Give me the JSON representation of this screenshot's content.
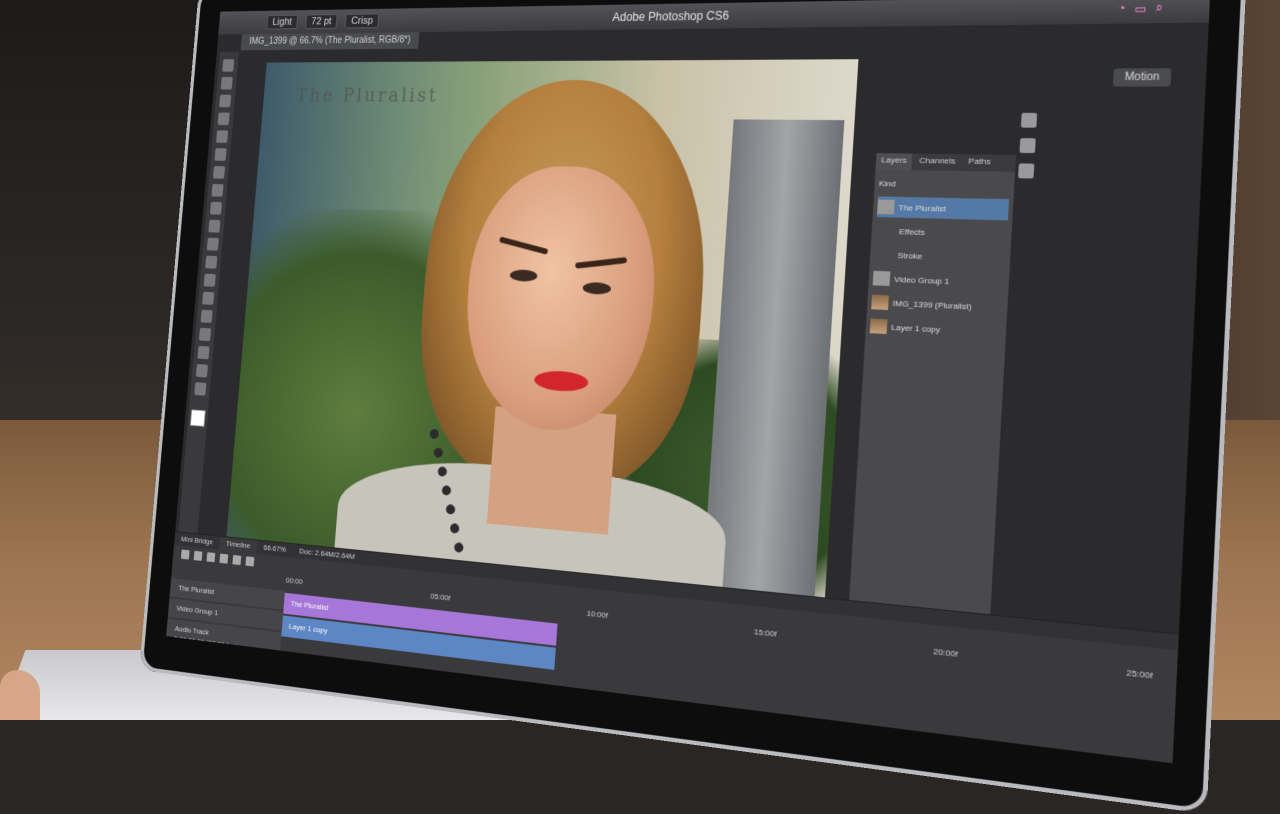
{
  "window": {
    "app_title": "Adobe Photoshop CS6",
    "doc_tab": "IMG_1399 @ 66.7% (The Pluralist, RGB/8*)"
  },
  "options_bar": {
    "style_field": "Light",
    "size_field": "72 pt",
    "aa_field": "Crisp"
  },
  "workspace": {
    "label": "Motion"
  },
  "canvas": {
    "watermark": "The Pluralist"
  },
  "layers_panel": {
    "tabs": [
      "Layers",
      "Channels",
      "Paths"
    ],
    "filter_label": "Kind",
    "layers": [
      {
        "name": "The Pluralist",
        "selected": true
      },
      {
        "name": "Effects"
      },
      {
        "name": "Stroke"
      },
      {
        "name": "Video Group 1"
      },
      {
        "name": "IMG_1399 (Pluralist)"
      },
      {
        "name": "Layer 1 copy"
      }
    ]
  },
  "timeline": {
    "tabs": [
      "Mini Bridge",
      "Timeline"
    ],
    "zoom": "66.67%",
    "doc_info": "Doc: 2.64M/2.64M",
    "ruler": [
      "00:00",
      "05:00f",
      "10:00f",
      "15:00f",
      "20:00f",
      "25:00f"
    ],
    "tracks": [
      "The Pluralist",
      "Video Group 1",
      "Audio Track"
    ],
    "clips": {
      "text_clip": "The Pluralist",
      "video_clip": "Layer 1 copy"
    },
    "status": "0;00;00;00  (30.00 fps)"
  }
}
